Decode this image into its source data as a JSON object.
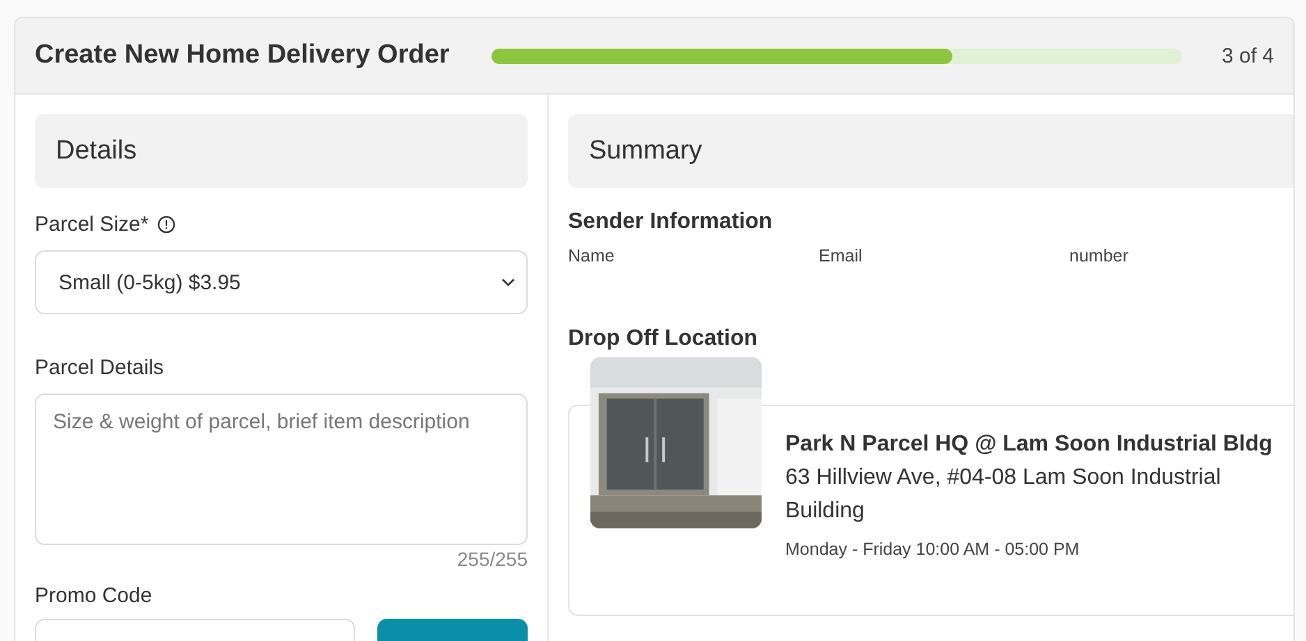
{
  "header": {
    "title": "Create New Home Delivery Order",
    "progress": {
      "level": 0.666
    },
    "step": "3 of 4"
  },
  "details": {
    "title": "Details",
    "parcel_size": {
      "label": "Parcel Size*",
      "value": "Small (0-5kg) $3.95"
    },
    "parcel_details": {
      "label": "Parcel Details",
      "placeholder": "Size & weight of parcel, brief item description",
      "counter": "255/255"
    },
    "promo_code": {
      "label": "Promo Code"
    }
  },
  "summary": {
    "title": "Summary",
    "sender": {
      "title": "Sender Information",
      "fields": [
        "Name",
        "Email",
        "number"
      ]
    },
    "drop_off": {
      "title": "Drop Off Location",
      "location": {
        "name": "Park N Parcel HQ @ Lam Soon Industrial Bldg",
        "address": "63 Hillview Ave, #04-08 Lam Soon Industrial Building",
        "hours": "Monday - Friday 10:00 AM - 05:00 PM"
      }
    }
  }
}
